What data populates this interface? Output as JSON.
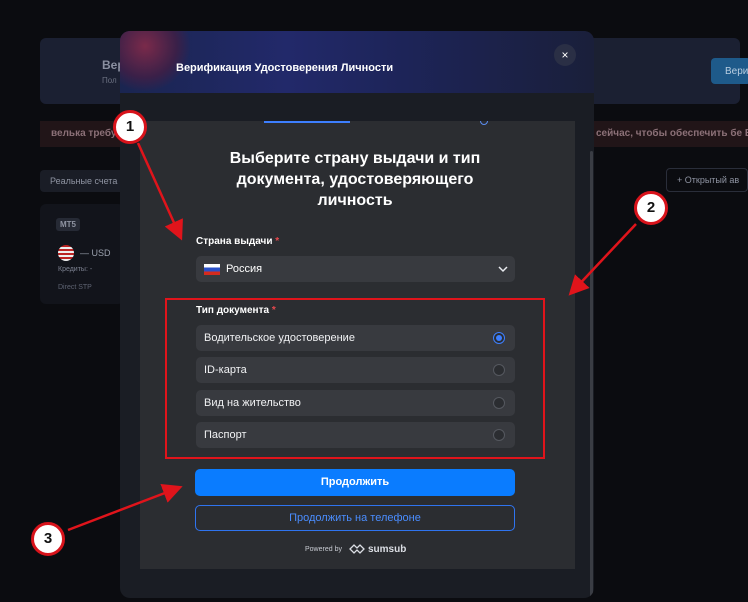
{
  "background": {
    "card_title": "Вер",
    "card_subtitle": "Пол",
    "right_button": "Вери",
    "warning_left": "велька требу",
    "warning_right": "сейчас, чтобы обеспечить бе  Вкл",
    "tab_real_accounts": "Реальные счета",
    "open_account_button": "+ Открытый ав",
    "account_badge": "МТ5",
    "account_currency": "— USD",
    "account_credit": "Кредиты: -",
    "account_type": "Direct STP"
  },
  "modal": {
    "title": "Верификация Удостоверения Личности",
    "close_label": "×",
    "heading": "Выберите страну выдачи и тип документа, удостоверяющего личность",
    "country_label": "Страна выдачи",
    "required_mark": "*",
    "country_value": "Россия",
    "doc_type_label": "Тип документа",
    "document_options": [
      {
        "label": "Водительское удостоверение",
        "selected": true
      },
      {
        "label": "ID-карта",
        "selected": false
      },
      {
        "label": "Вид на жительство",
        "selected": false
      },
      {
        "label": "Паспорт",
        "selected": false
      }
    ],
    "continue_button": "Продолжить",
    "continue_phone_button": "Продолжить на телефоне",
    "powered_by": "Powered by",
    "brand": "sumsub"
  },
  "annotations": {
    "badges": [
      "1",
      "2",
      "3"
    ],
    "color": "#e0141b"
  }
}
